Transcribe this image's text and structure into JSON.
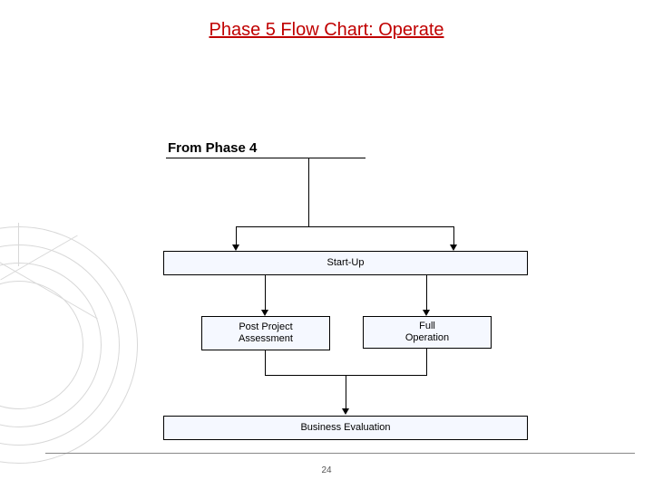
{
  "title": "Phase 5 Flow Chart: Operate",
  "from_label": "From Phase 4",
  "nodes": {
    "startup": "Start-Up",
    "post_project": "Post Project\nAssessment",
    "full_operation": "Full\nOperation",
    "business_eval": "Business Evaluation"
  },
  "page_number": "24",
  "chart_data": {
    "type": "flowchart",
    "title": "Phase 5 Flow Chart: Operate",
    "entry": "From Phase 4",
    "nodes": [
      {
        "id": "startup",
        "label": "Start-Up"
      },
      {
        "id": "post_project",
        "label": "Post Project Assessment"
      },
      {
        "id": "full_operation",
        "label": "Full Operation"
      },
      {
        "id": "business_eval",
        "label": "Business Evaluation"
      }
    ],
    "edges": [
      {
        "from": "From Phase 4",
        "to": "startup"
      },
      {
        "from": "startup",
        "to": "post_project"
      },
      {
        "from": "startup",
        "to": "full_operation"
      },
      {
        "from": "post_project",
        "to": "business_eval"
      },
      {
        "from": "full_operation",
        "to": "business_eval"
      }
    ]
  }
}
